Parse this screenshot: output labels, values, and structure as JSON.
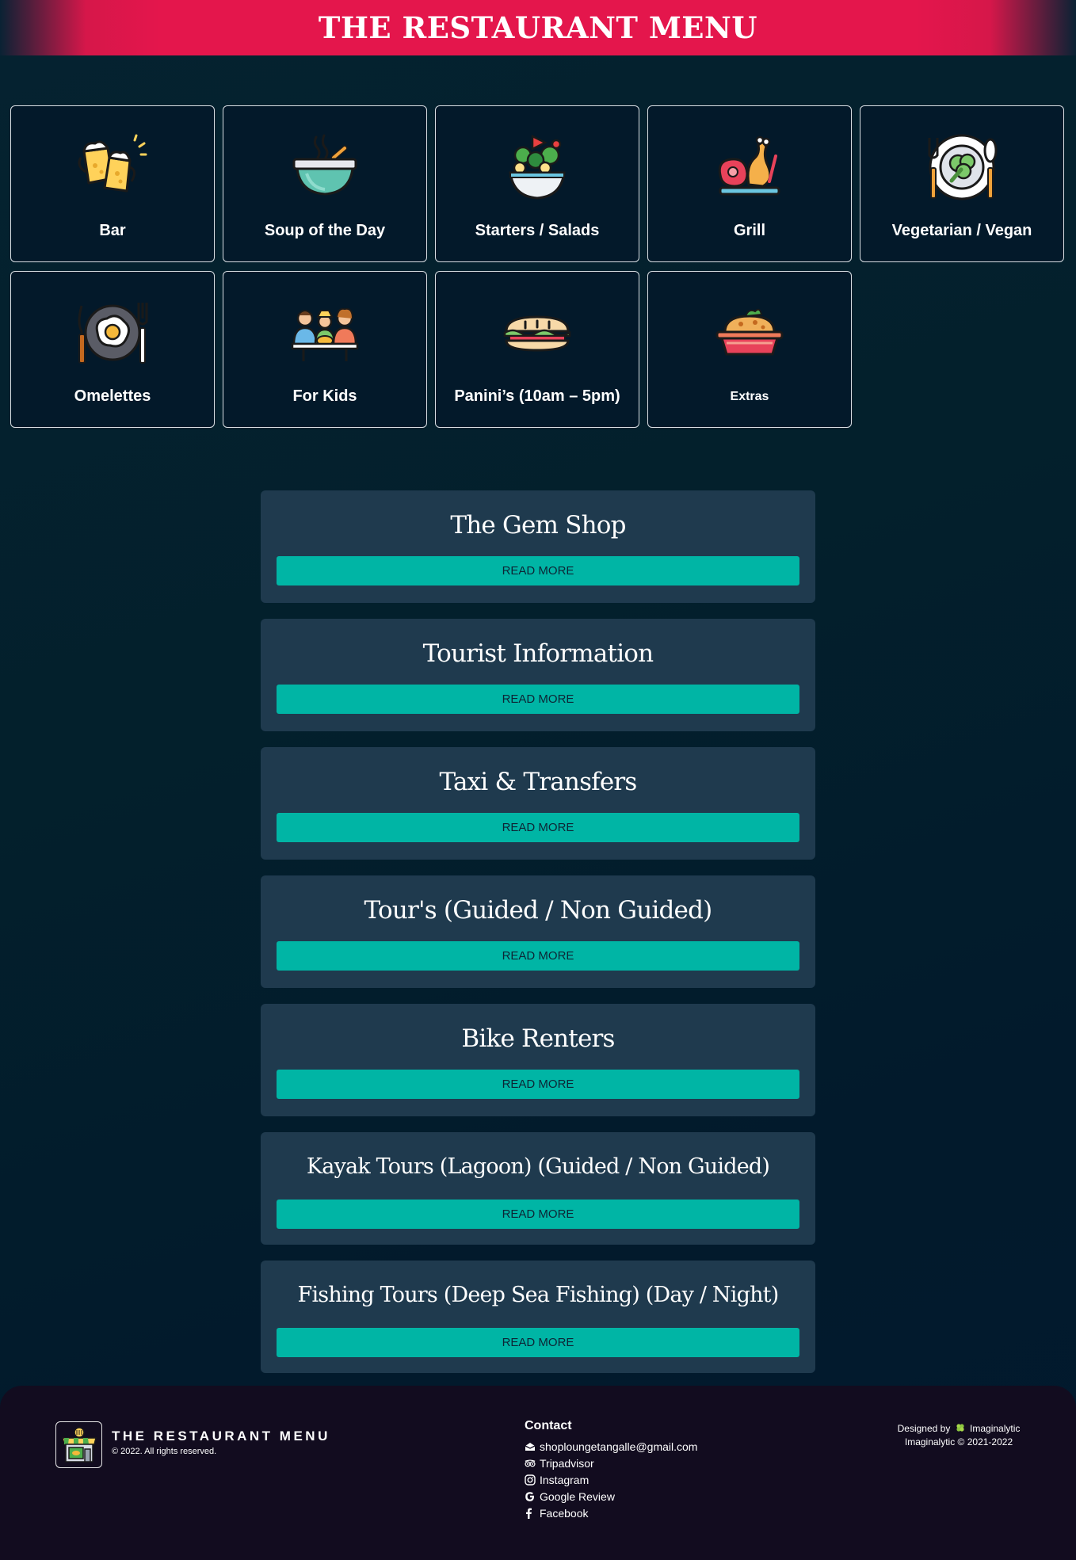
{
  "header": {
    "title": "THE RESTAURANT MENU"
  },
  "categories": [
    {
      "label": "Bar",
      "icon": "beer-mugs-icon"
    },
    {
      "label": "Soup of the Day",
      "icon": "soup-bowl-icon"
    },
    {
      "label": "Starters / Salads",
      "icon": "salad-bowl-icon"
    },
    {
      "label": "Grill",
      "icon": "grilled-meat-icon"
    },
    {
      "label": "Vegetarian / Vegan",
      "icon": "vegetable-plate-icon"
    },
    {
      "label": "Omelettes",
      "icon": "fried-egg-plate-icon"
    },
    {
      "label": "For Kids",
      "icon": "kids-table-icon"
    },
    {
      "label": "Panini’s (10am – 5pm)",
      "icon": "sandwich-icon"
    },
    {
      "label": "Extras",
      "icon": "casserole-dish-icon"
    }
  ],
  "services": [
    {
      "title": "The Gem Shop",
      "button": "READ MORE"
    },
    {
      "title": "Tourist Information",
      "button": "READ MORE"
    },
    {
      "title": "Taxi & Transfers",
      "button": "READ MORE"
    },
    {
      "title": "Tour's (Guided / Non Guided)",
      "button": "READ MORE"
    },
    {
      "title": "Bike Renters",
      "button": "READ MORE"
    },
    {
      "title": "Kayak Tours (Lagoon) (Guided / Non Guided)",
      "button": "READ MORE"
    },
    {
      "title": "Fishing Tours (Deep Sea Fishing) (Day / Night)",
      "button": "READ MORE"
    }
  ],
  "footer": {
    "brand_title": "THE RESTAURANT MENU",
    "copyright": "© 2022. All rights reserved.",
    "contact_title": "Contact",
    "contact": [
      {
        "label": "shoploungetangalle@gmail.com",
        "icon": "envelope-icon"
      },
      {
        "label": "Tripadvisor",
        "icon": "tripadvisor-icon"
      },
      {
        "label": "Instagram",
        "icon": "instagram-icon"
      },
      {
        "label": "Google Review",
        "icon": "google-icon"
      },
      {
        "label": "Facebook",
        "icon": "facebook-icon"
      }
    ],
    "designed_by": "Designed by",
    "designer": "Imaginalytic",
    "designer_copy": "Imaginalytic © 2021-2022"
  },
  "colors": {
    "header_bg": "#e4164c",
    "page_bg": "#03202c",
    "service_bg": "#1f3a4e",
    "button_bg": "#00b5a5",
    "footer_bg": "#120c1f"
  }
}
